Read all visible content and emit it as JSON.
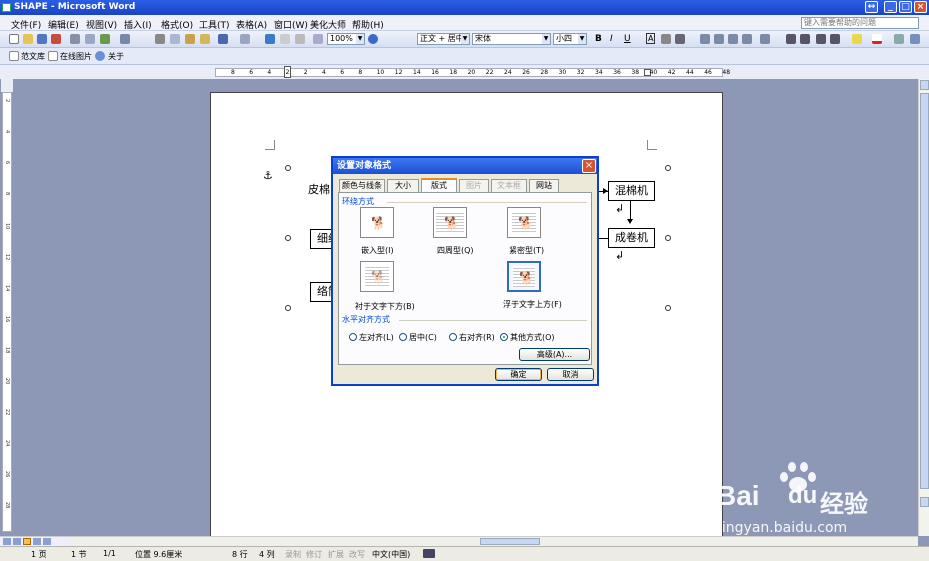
{
  "window": {
    "title": "SHAPE - Microsoft Word"
  },
  "menu": {
    "items": [
      "文件(F)",
      "编辑(E)",
      "视图(V)",
      "插入(I)",
      "格式(O)",
      "工具(T)",
      "表格(A)",
      "窗口(W)",
      "美化大师",
      "帮助(H)"
    ],
    "help_placeholder": "键入需要帮助的问题"
  },
  "toolbar": {
    "zoom": "100%",
    "style": "正文 + 居中",
    "font": "宋体",
    "size": "小四",
    "bold": "B",
    "italic": "I",
    "underline": "U",
    "char_border": "A"
  },
  "toolbar2": {
    "fanwenku": "范文库",
    "online_images": "在线图片",
    "about": "关于"
  },
  "ruler": {
    "numbers": [
      "8",
      "6",
      "4",
      "2",
      "2",
      "4",
      "6",
      "8",
      "10",
      "12",
      "14",
      "16",
      "18",
      "20",
      "22",
      "24",
      "26",
      "28",
      "30",
      "32",
      "34",
      "36",
      "38",
      "40",
      "42",
      "44",
      "46",
      "48"
    ]
  },
  "vruler": {
    "numbers": [
      "2",
      "4",
      "6",
      "8",
      "10",
      "12",
      "14",
      "16",
      "18",
      "20",
      "22",
      "24",
      "26",
      "28"
    ]
  },
  "document": {
    "boxes": {
      "b1": "皮棉",
      "b2": "细纱",
      "b3": "络筒",
      "b4": "混棉机↲",
      "b5": "成卷机↲"
    },
    "anchor": "⚓"
  },
  "dialog": {
    "title": "设置对象格式",
    "tabs": [
      "颜色与线条",
      "大小",
      "版式",
      "图片",
      "文本框",
      "网站"
    ],
    "active_tab": "版式",
    "wrap_group_label": "环绕方式",
    "wrap_options": [
      "嵌入型(I)",
      "四周型(Q)",
      "紧密型(T)",
      "衬于文字下方(B)",
      "浮于文字上方(F)"
    ],
    "selected_wrap": "浮于文字上方(F)",
    "halign_group_label": "水平对齐方式",
    "halign_options": [
      "左对齐(L)",
      "居中(C)",
      "右对齐(R)",
      "其他方式(O)"
    ],
    "selected_halign": "其他方式(O)",
    "advanced_button": "高级(A)...",
    "ok_button": "确定",
    "cancel_button": "取消"
  },
  "status": {
    "page": "1 页",
    "section": "1 节",
    "page_of": "1/1",
    "position": "位置 9.6厘米",
    "line": "8 行",
    "column": "4 列",
    "rec": "录制",
    "trk": "修订",
    "ext": "扩展",
    "ovr": "改写",
    "language": "中文(中国)"
  },
  "watermark": {
    "brand": "Bai",
    "brand2": "du",
    "brand3": "经验",
    "url": "jingyan.baidu.com"
  }
}
